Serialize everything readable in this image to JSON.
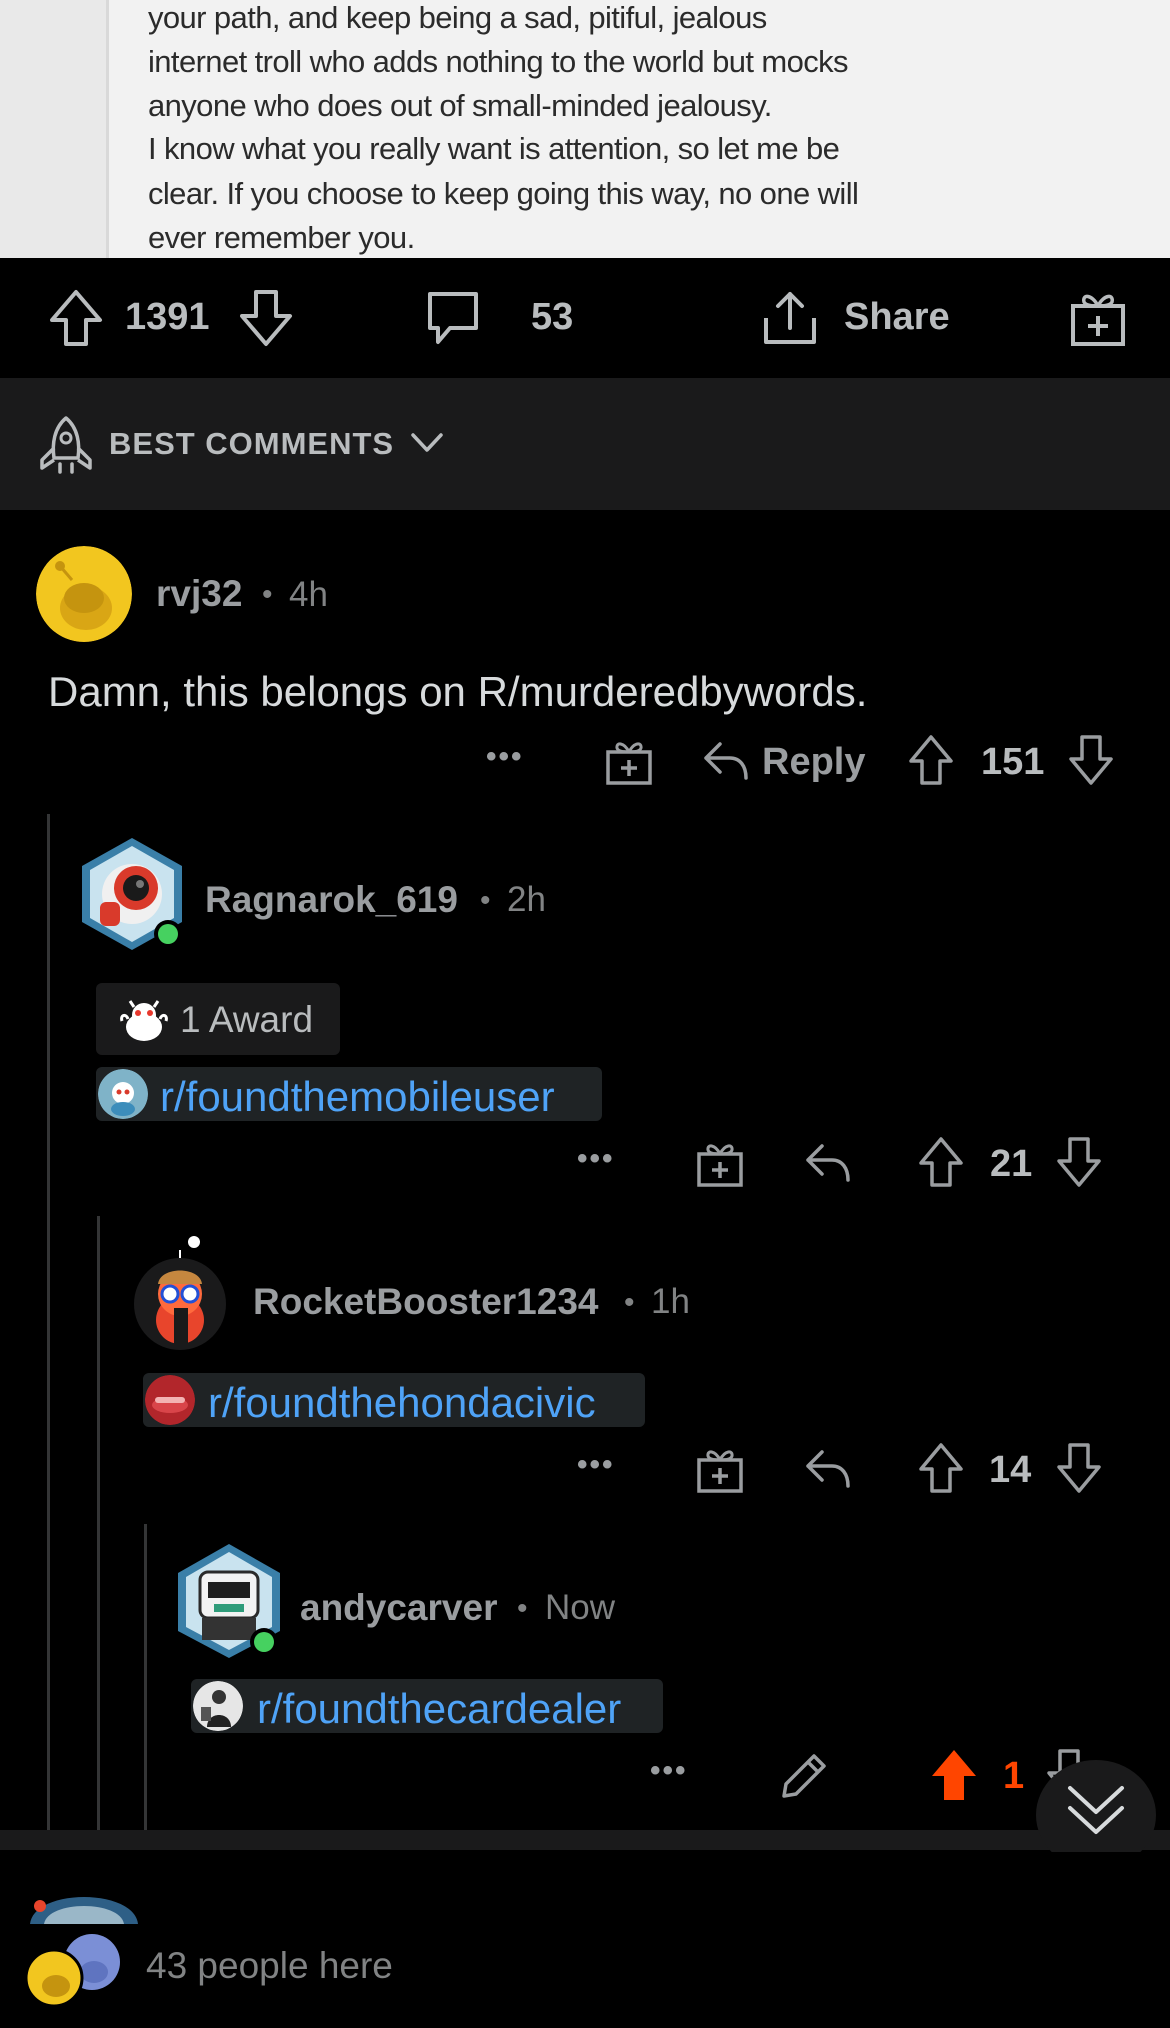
{
  "post_image": {
    "lines": [
      "your path, and keep being a sad, pitiful, jealous",
      "internet troll who adds nothing to the world but mocks",
      "anyone who does out of small-minded jealousy.",
      "I know what you really want is attention, so let me be",
      "clear. If you choose to keep going this way, no one will",
      "ever remember you."
    ]
  },
  "post_actions": {
    "vote_count": "1391",
    "comment_count": "53",
    "share_label": "Share"
  },
  "sort": {
    "label": "BEST COMMENTS"
  },
  "comments": [
    {
      "username": "rvj32",
      "sep": "•",
      "time": "4h",
      "body": "Damn, this belongs on R/murderedbywords.",
      "more": "•••",
      "reply_label": "Reply",
      "score": "151"
    },
    {
      "username": "Ragnarok_619",
      "sep": "•",
      "time": "2h",
      "award_label": "1 Award",
      "link": "r/foundthemobileuser",
      "more": "•••",
      "score": "21"
    },
    {
      "username": "RocketBooster1234",
      "sep": "•",
      "time": "1h",
      "link": "r/foundthehondacivic",
      "more": "•••",
      "score": "14"
    },
    {
      "username": "andycarver",
      "sep": "•",
      "time": "Now",
      "link": "r/foundthecardealer",
      "more": "•••",
      "score": "1"
    }
  ],
  "presence": {
    "label": "43 people here"
  },
  "colors": {
    "background": "#000000",
    "link": "#4fa3f7",
    "upvote_active": "#ff4500",
    "online": "#46d160"
  }
}
